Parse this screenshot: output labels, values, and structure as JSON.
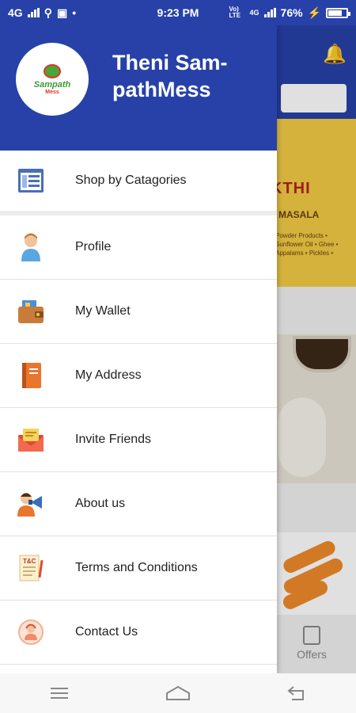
{
  "status_bar": {
    "network_left": "4G",
    "time": "9:23 PM",
    "volte": "Vo) LTE",
    "network_right": "4G",
    "battery_percent": "76%",
    "battery_level": 0.76
  },
  "drawer": {
    "title": "Theni Sam-pathMess",
    "logo_text": "Sampath",
    "logo_sub": "Mess",
    "items": [
      {
        "label": "Shop by Catagories",
        "icon": "catalog-icon"
      },
      {
        "label": "Profile",
        "icon": "person-icon"
      },
      {
        "label": "My Wallet",
        "icon": "wallet-icon"
      },
      {
        "label": "My Address",
        "icon": "address-book-icon"
      },
      {
        "label": "Invite Friends",
        "icon": "envelope-icon"
      },
      {
        "label": "About us",
        "icon": "megaphone-icon"
      },
      {
        "label": "Terms and Conditions",
        "icon": "terms-icon"
      },
      {
        "label": "Contact Us",
        "icon": "contact-icon"
      }
    ]
  },
  "background": {
    "banner_brand": "KTHI",
    "banner_sub": "MASALA",
    "banner_detail": "Powder Products • Sunflower Oil • Ghee • Appalams • Pickles •",
    "offers_label": "Offers"
  },
  "colors": {
    "primary": "#2741a8",
    "banner": "#f2cb45"
  }
}
